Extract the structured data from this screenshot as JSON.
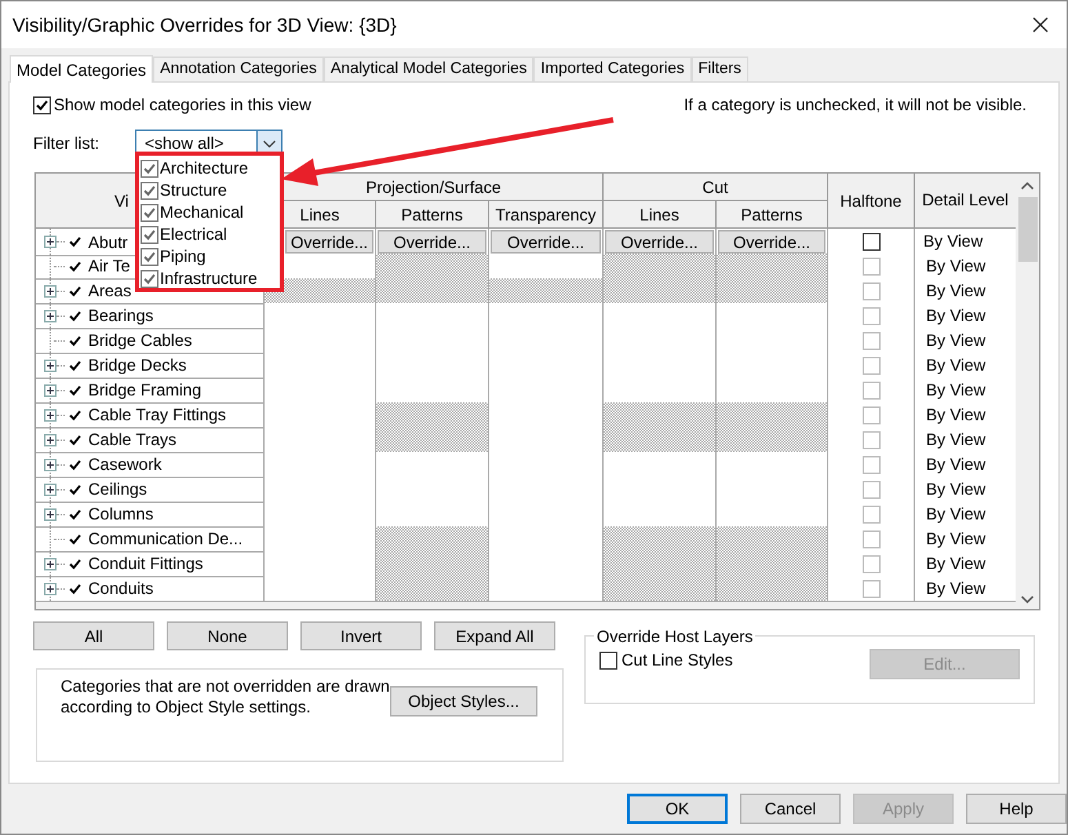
{
  "window": {
    "title": "Visibility/Graphic Overrides for 3D View: {3D}"
  },
  "tabs": [
    {
      "label": "Model Categories",
      "selected": true
    },
    {
      "label": "Annotation Categories",
      "selected": false
    },
    {
      "label": "Analytical Model Categories",
      "selected": false
    },
    {
      "label": "Imported Categories",
      "selected": false
    },
    {
      "label": "Filters",
      "selected": false
    }
  ],
  "show_categories": {
    "label": "Show model categories in this view",
    "checked": true
  },
  "hint": "If a category is unchecked, it will not be visible.",
  "filter": {
    "label": "Filter list:",
    "value": "<show all>",
    "options": [
      {
        "label": "Architecture",
        "checked": true
      },
      {
        "label": "Structure",
        "checked": true
      },
      {
        "label": "Mechanical",
        "checked": true
      },
      {
        "label": "Electrical",
        "checked": true
      },
      {
        "label": "Piping",
        "checked": true
      },
      {
        "label": "Infrastructure",
        "checked": true
      }
    ]
  },
  "table": {
    "header": {
      "visibility": "Vi",
      "projection": "Projection/Surface",
      "cut": "Cut",
      "halftone": "Halftone",
      "detail": "Detail Level",
      "sub": [
        "Lines",
        "Patterns",
        "Transparency",
        "Lines",
        "Patterns"
      ]
    },
    "rows": [
      {
        "name": "Abutr",
        "expandable": true,
        "visible": true,
        "selected": true,
        "halftone": false,
        "detail": "By View",
        "cells": [
          {
            "kind": "button",
            "label": "Override..."
          },
          {
            "kind": "button",
            "label": "Override..."
          },
          {
            "kind": "button",
            "label": "Override..."
          },
          {
            "kind": "button",
            "label": "Override..."
          },
          {
            "kind": "button",
            "label": "Override..."
          }
        ]
      },
      {
        "name": "Air Te",
        "expandable": false,
        "visible": true,
        "selected": false,
        "halftone": false,
        "detail": "By View",
        "cells": [
          {
            "kind": "blank"
          },
          {
            "kind": "hatched"
          },
          {
            "kind": "blank"
          },
          {
            "kind": "hatched"
          },
          {
            "kind": "hatched"
          }
        ]
      },
      {
        "name": "Areas",
        "expandable": true,
        "visible": true,
        "selected": false,
        "halftone": false,
        "detail": "By View",
        "cells": [
          {
            "kind": "hatched"
          },
          {
            "kind": "hatched"
          },
          {
            "kind": "hatched"
          },
          {
            "kind": "hatched"
          },
          {
            "kind": "hatched"
          }
        ]
      },
      {
        "name": "Bearings",
        "expandable": true,
        "visible": true,
        "selected": false,
        "halftone": false,
        "detail": "By View",
        "cells": [
          {
            "kind": "blank"
          },
          {
            "kind": "blank"
          },
          {
            "kind": "blank"
          },
          {
            "kind": "blank"
          },
          {
            "kind": "blank"
          }
        ]
      },
      {
        "name": "Bridge Cables",
        "expandable": false,
        "visible": true,
        "selected": false,
        "halftone": false,
        "detail": "By View",
        "cells": [
          {
            "kind": "blank"
          },
          {
            "kind": "blank"
          },
          {
            "kind": "blank"
          },
          {
            "kind": "blank"
          },
          {
            "kind": "blank"
          }
        ]
      },
      {
        "name": "Bridge Decks",
        "expandable": true,
        "visible": true,
        "selected": false,
        "halftone": false,
        "detail": "By View",
        "cells": [
          {
            "kind": "blank"
          },
          {
            "kind": "blank"
          },
          {
            "kind": "blank"
          },
          {
            "kind": "blank"
          },
          {
            "kind": "blank"
          }
        ]
      },
      {
        "name": "Bridge Framing",
        "expandable": true,
        "visible": true,
        "selected": false,
        "halftone": false,
        "detail": "By View",
        "cells": [
          {
            "kind": "blank"
          },
          {
            "kind": "blank"
          },
          {
            "kind": "blank"
          },
          {
            "kind": "blank"
          },
          {
            "kind": "blank"
          }
        ]
      },
      {
        "name": "Cable Tray Fittings",
        "expandable": true,
        "visible": true,
        "selected": false,
        "halftone": false,
        "detail": "By View",
        "cells": [
          {
            "kind": "blank"
          },
          {
            "kind": "hatched"
          },
          {
            "kind": "blank"
          },
          {
            "kind": "hatched"
          },
          {
            "kind": "hatched"
          }
        ]
      },
      {
        "name": "Cable Trays",
        "expandable": true,
        "visible": true,
        "selected": false,
        "halftone": false,
        "detail": "By View",
        "cells": [
          {
            "kind": "blank"
          },
          {
            "kind": "hatched"
          },
          {
            "kind": "blank"
          },
          {
            "kind": "hatched"
          },
          {
            "kind": "hatched"
          }
        ]
      },
      {
        "name": "Casework",
        "expandable": true,
        "visible": true,
        "selected": false,
        "halftone": false,
        "detail": "By View",
        "cells": [
          {
            "kind": "blank"
          },
          {
            "kind": "blank"
          },
          {
            "kind": "blank"
          },
          {
            "kind": "blank"
          },
          {
            "kind": "blank"
          }
        ]
      },
      {
        "name": "Ceilings",
        "expandable": true,
        "visible": true,
        "selected": false,
        "halftone": false,
        "detail": "By View",
        "cells": [
          {
            "kind": "blank"
          },
          {
            "kind": "blank"
          },
          {
            "kind": "blank"
          },
          {
            "kind": "blank"
          },
          {
            "kind": "blank"
          }
        ]
      },
      {
        "name": "Columns",
        "expandable": true,
        "visible": true,
        "selected": false,
        "halftone": false,
        "detail": "By View",
        "cells": [
          {
            "kind": "blank"
          },
          {
            "kind": "blank"
          },
          {
            "kind": "blank"
          },
          {
            "kind": "blank"
          },
          {
            "kind": "blank"
          }
        ]
      },
      {
        "name": "Communication De...",
        "expandable": false,
        "visible": true,
        "selected": false,
        "halftone": false,
        "detail": "By View",
        "cells": [
          {
            "kind": "blank"
          },
          {
            "kind": "hatched"
          },
          {
            "kind": "blank"
          },
          {
            "kind": "hatched"
          },
          {
            "kind": "hatched"
          }
        ]
      },
      {
        "name": "Conduit Fittings",
        "expandable": true,
        "visible": true,
        "selected": false,
        "halftone": false,
        "detail": "By View",
        "cells": [
          {
            "kind": "blank"
          },
          {
            "kind": "hatched"
          },
          {
            "kind": "blank"
          },
          {
            "kind": "hatched"
          },
          {
            "kind": "hatched"
          }
        ]
      },
      {
        "name": "Conduits",
        "expandable": true,
        "visible": true,
        "selected": false,
        "halftone": false,
        "detail": "By View",
        "cells": [
          {
            "kind": "blank"
          },
          {
            "kind": "hatched"
          },
          {
            "kind": "blank"
          },
          {
            "kind": "hatched"
          },
          {
            "kind": "hatched"
          }
        ]
      }
    ]
  },
  "table_buttons": [
    "All",
    "None",
    "Invert",
    "Expand All"
  ],
  "note": {
    "text": "Categories that are not overridden are drawn according to Object Style settings.",
    "button": "Object Styles..."
  },
  "host_layers": {
    "title": "Override Host Layers",
    "checkbox": {
      "label": "Cut Line Styles",
      "checked": false
    },
    "button": {
      "label": "Edit...",
      "disabled": true
    }
  },
  "footer": [
    {
      "label": "OK",
      "disabled": false,
      "default": true
    },
    {
      "label": "Cancel",
      "disabled": false,
      "default": false
    },
    {
      "label": "Apply",
      "disabled": true,
      "default": false
    },
    {
      "label": "Help",
      "disabled": false,
      "default": false
    }
  ]
}
